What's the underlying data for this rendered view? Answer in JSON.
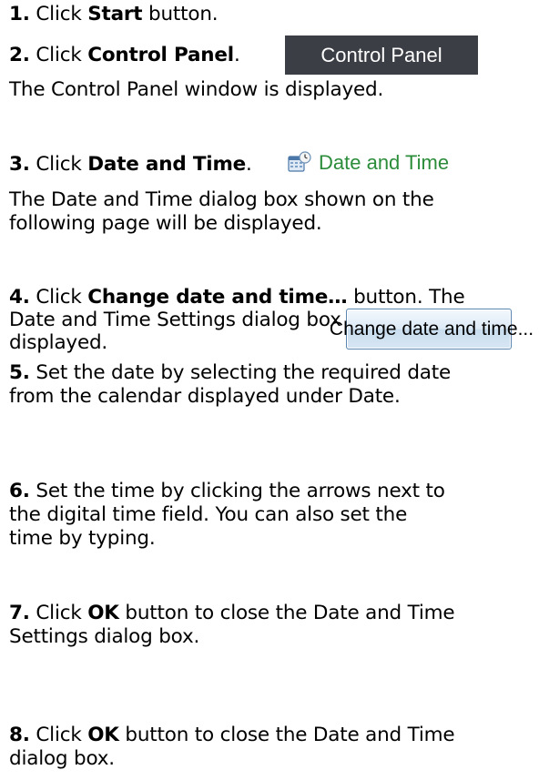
{
  "steps": [
    {
      "num": "1.",
      "pre": " Click ",
      "bold": "Start",
      "post": " button."
    },
    {
      "num": "2.",
      "pre": " Click ",
      "bold": "Control Panel",
      "post": "."
    },
    {
      "text": " The Control Panel window is displayed."
    },
    {
      "num": "3.",
      "pre": " Click ",
      "bold": "Date and Time",
      "post": "."
    },
    {
      "text": "The Date and Time dialog box shown on the"
    },
    {
      "text": "following page will be displayed."
    },
    {
      "num": "4.",
      "pre": " Click ",
      "bold": "Change date and time…",
      "post": " button. The"
    },
    {
      "text": "Date and Time Settings dialog box will be"
    },
    {
      "text": "displayed."
    },
    {
      "num": "5.",
      "post": " Set the date by selecting the required date"
    },
    {
      "text": "from the calendar displayed under Date."
    },
    {
      "num": "6.",
      "post": " Set the time by clicking the arrows next to"
    },
    {
      "text": "the digital time field. You can also set the"
    },
    {
      "text": "time by typing."
    },
    {
      "num": "7.",
      "pre": " Click ",
      "bold": "OK",
      "post": " button to close the Date and Time"
    },
    {
      "text": "Settings dialog box."
    },
    {
      "num": "8.",
      "pre": " Click ",
      "bold": "OK",
      "post": " button to close the Date and Time"
    },
    {
      "text": "dialog box."
    }
  ],
  "ui_snippets": {
    "control_panel": {
      "label": "Control Panel",
      "bg": "#3b3e44",
      "fg": "#ffffff"
    },
    "date_time_link": {
      "label": "Date and Time",
      "color": "#2b8c3a",
      "icon": "calendar-clock-icon"
    },
    "change_button": {
      "label": "Change date and time...",
      "icon": "uac-shield-icon"
    }
  }
}
